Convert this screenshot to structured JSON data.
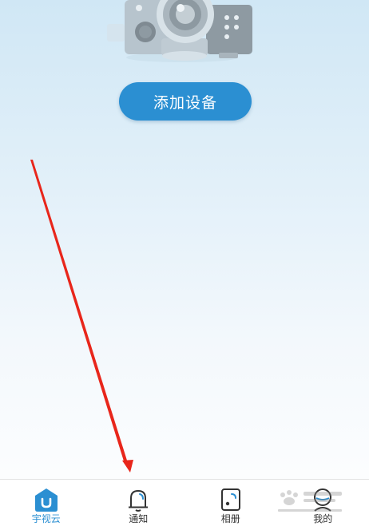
{
  "main": {
    "add_device_label": "添加设备"
  },
  "tabbar": {
    "tabs": [
      {
        "label": "宇视云",
        "icon": "home-icon",
        "active": true
      },
      {
        "label": "通知",
        "icon": "bell-icon",
        "active": false
      },
      {
        "label": "相册",
        "icon": "album-icon",
        "active": false
      },
      {
        "label": "我的",
        "icon": "profile-icon",
        "active": false
      }
    ]
  },
  "colors": {
    "accent": "#2b8fd2",
    "annotation": "#e8261b"
  },
  "overlay": {
    "annotation_arrow": "red arrow pointing to notification tab",
    "watermark": "Baidu jingyan watermark"
  }
}
